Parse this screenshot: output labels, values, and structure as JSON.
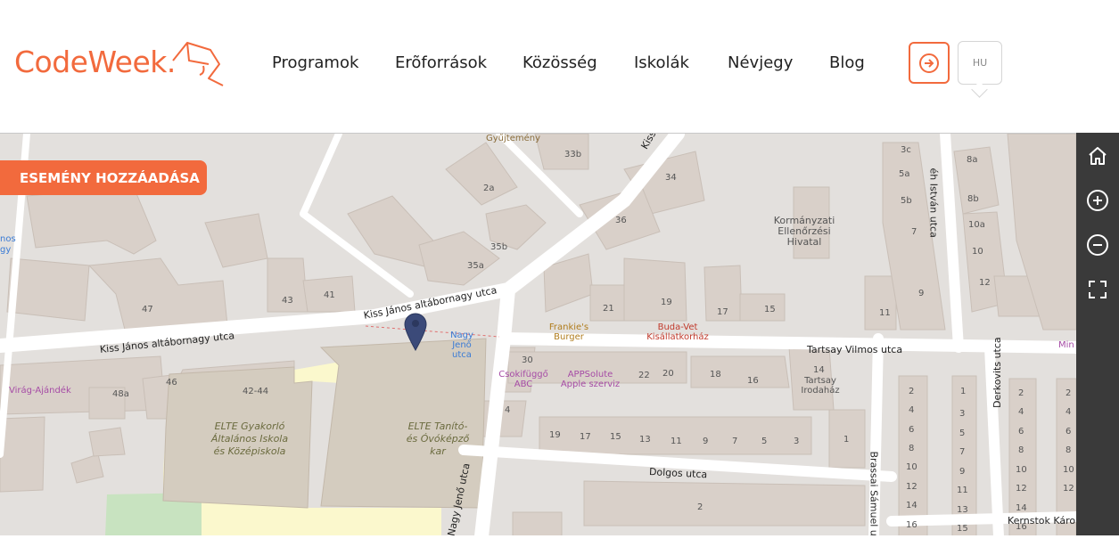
{
  "logo": {
    "text": "CodeWeek."
  },
  "nav": {
    "items": [
      {
        "label": "Programok"
      },
      {
        "label": "Erõforrások"
      },
      {
        "label": "Közösség"
      },
      {
        "label": "Iskolák"
      },
      {
        "label": "Névjegy"
      },
      {
        "label": "Blog"
      }
    ]
  },
  "login": {
    "icon": "login-arrow-icon"
  },
  "language": {
    "code": "HU"
  },
  "map": {
    "add_event_label": "ESEMÉNY HOZZÁADÁSA",
    "streets": {
      "kiss1": "Kiss János altábornagy utca",
      "kiss2": "Kiss János altábornagy utca",
      "tartsay": "Tartsay Vilmos utca",
      "dolgos": "Dolgos utca",
      "brassai": "Brassai Sámuel utca",
      "derkovits": "Derkovits utca",
      "istvan": "éh István utca",
      "kernstok": "Kernstok Károly",
      "nagyjeno": "Nagy Jenő utca",
      "kiss_top": "Kiss"
    },
    "places": {
      "kormanyzati": "Kormányzati Ellenőrzési Hivatal",
      "frankies": "Frankie's Burger",
      "budavet": "Buda-Vet Kisállatkorház",
      "csokifuggo": "Csokifüggő ABC",
      "appsolute": "APPSolute Apple szerviz",
      "tartsay_iroda": "Tartsay Irodaház",
      "virag": "Virág-Ajándék",
      "nagyjeno_stop": "Nagy Jenő utca",
      "gyujtemeny": "Gyűjtemény",
      "elte_gyak": "ELTE Gyakorló Általános Iskola és Középiskola",
      "elte_tanito": "ELTE Tanító- és Óvóképző kar",
      "left_nos": "nos",
      "left_gy": "gy",
      "right_min": "Min"
    },
    "numbers": {
      "n33b": "33b",
      "n2a": "2a",
      "n34": "34",
      "n36": "36",
      "n35b": "35b",
      "n35a": "35a",
      "n43": "43",
      "n41": "41",
      "n47": "47",
      "n21": "21",
      "n19": "19",
      "n17": "17",
      "n15": "15",
      "n11": "11",
      "n9": "9",
      "n7": "7",
      "n5b": "5b",
      "n5a": "5a",
      "n3c": "3c",
      "n8a": "8a",
      "n8b": "8b",
      "n10a": "10a",
      "n10": "10",
      "n12": "12",
      "n48a": "48a",
      "n46": "46",
      "n42_44": "42-44",
      "n30": "30",
      "n22": "22",
      "n20": "20",
      "n18": "18",
      "n16": "16",
      "n14": "14",
      "n4": "4",
      "n1": "1",
      "n3": "3",
      "r19": "19",
      "r17": "17",
      "r15": "15",
      "r13": "13",
      "r11": "11",
      "r9": "9",
      "r7": "7",
      "r5": "5",
      "r3": "3",
      "b2": "2",
      "c2": "2",
      "c4": "4",
      "c6": "6",
      "c8": "8",
      "c10": "10",
      "c12": "12",
      "c14": "14",
      "c16": "16",
      "d1": "1",
      "d3": "3",
      "d5": "5",
      "d7": "7",
      "d9": "9",
      "d11": "11",
      "d13": "13",
      "d15": "15",
      "e2": "2",
      "e4": "4",
      "e6": "6",
      "e8": "8",
      "e10": "10",
      "e12": "12",
      "e14": "14",
      "e16": "16",
      "f2": "2",
      "f4": "4",
      "f6": "6",
      "f8": "8",
      "f10": "10",
      "f12": "12"
    }
  },
  "toolbar": {
    "home": "home-icon",
    "zoom_in": "zoom-in-icon",
    "zoom_out": "zoom-out-icon",
    "fullscreen": "fullscreen-icon"
  },
  "colors": {
    "brand": "#f26a3d",
    "map_bg": "#e3e0dd",
    "building": "#d9d0c9",
    "road": "#ffffff",
    "campus": "#fbf8cd",
    "park": "#c8e3c0",
    "marker": "#3b4a79",
    "toolbar": "#3a3a3a"
  }
}
